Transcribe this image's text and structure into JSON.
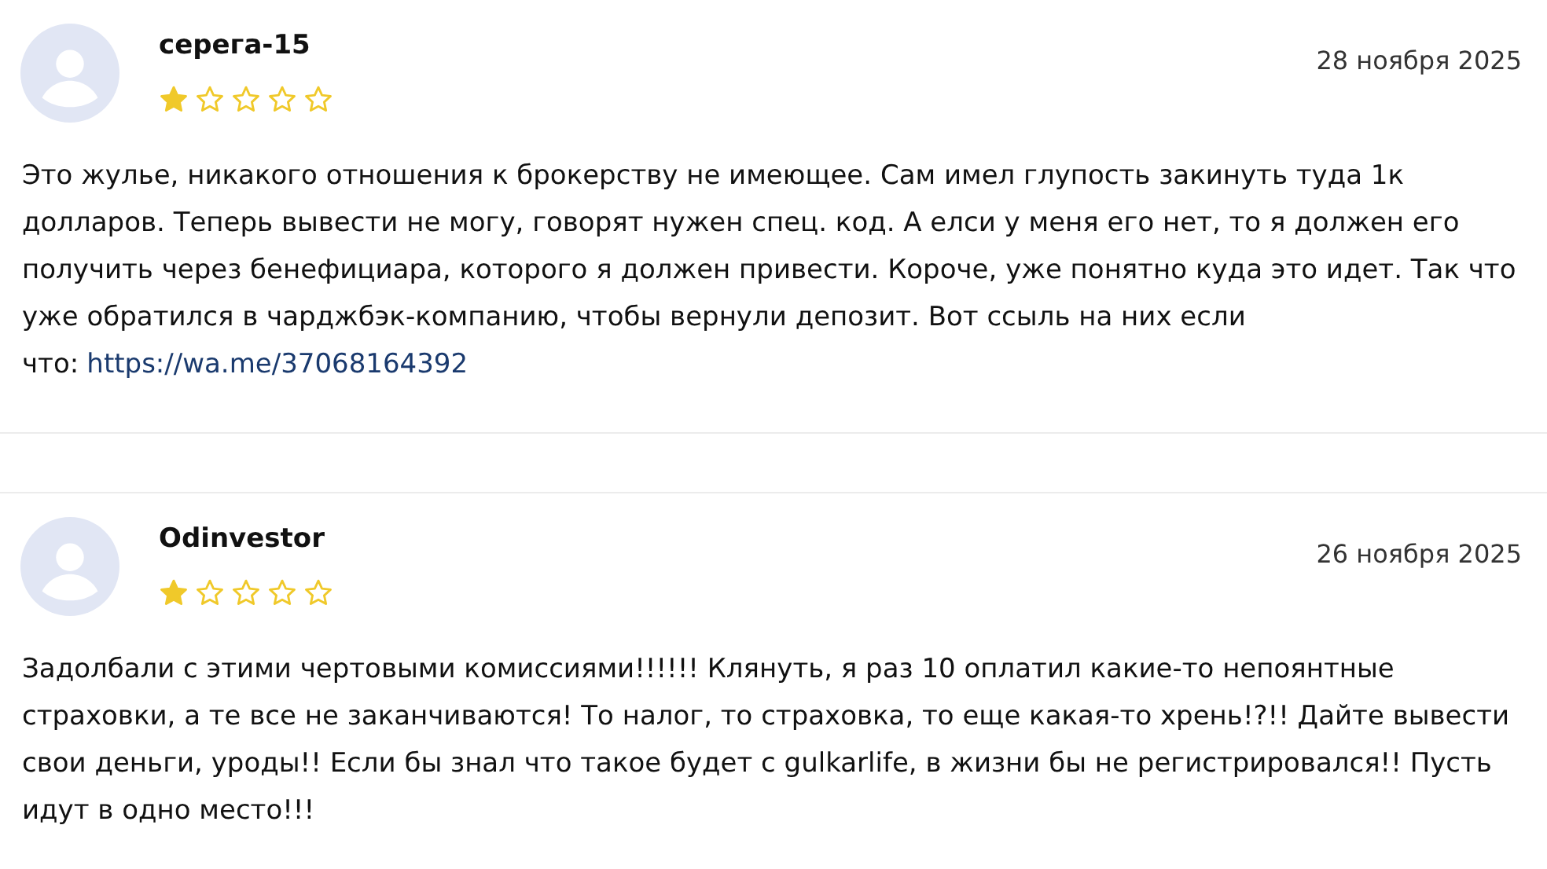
{
  "reviews": [
    {
      "author": "серега-15",
      "date": "28 ноября 2025",
      "stars": 1,
      "text": "Это жулье, никакого отношения к брокерству не имеющее. Сам имел глупость закинуть туда 1к долларов. Теперь вывести не могу, говорят нужен спец. код. А елси у меня его нет, то я должен его получить через бенефициара, которого я должен привести. Короче, уже понятно куда это идет. Так что уже обратился в чарджбэк-компанию, чтобы вернули депозит. Вот ссыль на них если что:",
      "link": "https://wa.me/37068164392"
    },
    {
      "author": "Odinvestor",
      "date": "26 ноября 2025",
      "stars": 1,
      "text": "Задолбали с этими чертовыми комиссиями!!!!!! Клянуть, я раз 10 оплатил какие-то непоянтные страховки, а те все не заканчиваются! То налог, то страховка, то еще какая-то хрень!?!! Дайте вывести свои деньги, уроды!! Если бы знал что такое будет с gulkarlife, в жизни бы не регистрировался!! Пусть идут в одно место!!!"
    }
  ]
}
